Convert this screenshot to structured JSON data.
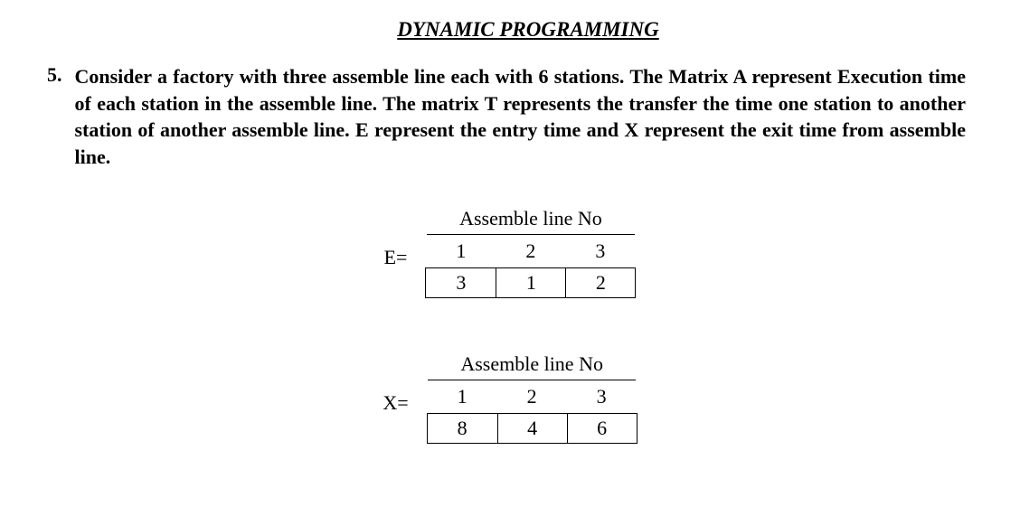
{
  "title": "DYNAMIC PROGRAMMING",
  "problem": {
    "number": "5.",
    "text": "Consider a factory with three assemble line each with 6 stations. The Matrix A represent Execution time of each station in the assemble line. The matrix T represents the transfer the time one station to another station of another assemble line. E represent the entry time and X represent the exit time from assemble line."
  },
  "tables": {
    "entry": {
      "label": "E=",
      "caption": "Assemble line No",
      "columns": [
        "1",
        "2",
        "3"
      ],
      "values": [
        "3",
        "1",
        "2"
      ]
    },
    "exit": {
      "label": "X=",
      "caption": "Assemble line No",
      "columns": [
        "1",
        "2",
        "3"
      ],
      "values": [
        "8",
        "4",
        "6"
      ]
    }
  }
}
